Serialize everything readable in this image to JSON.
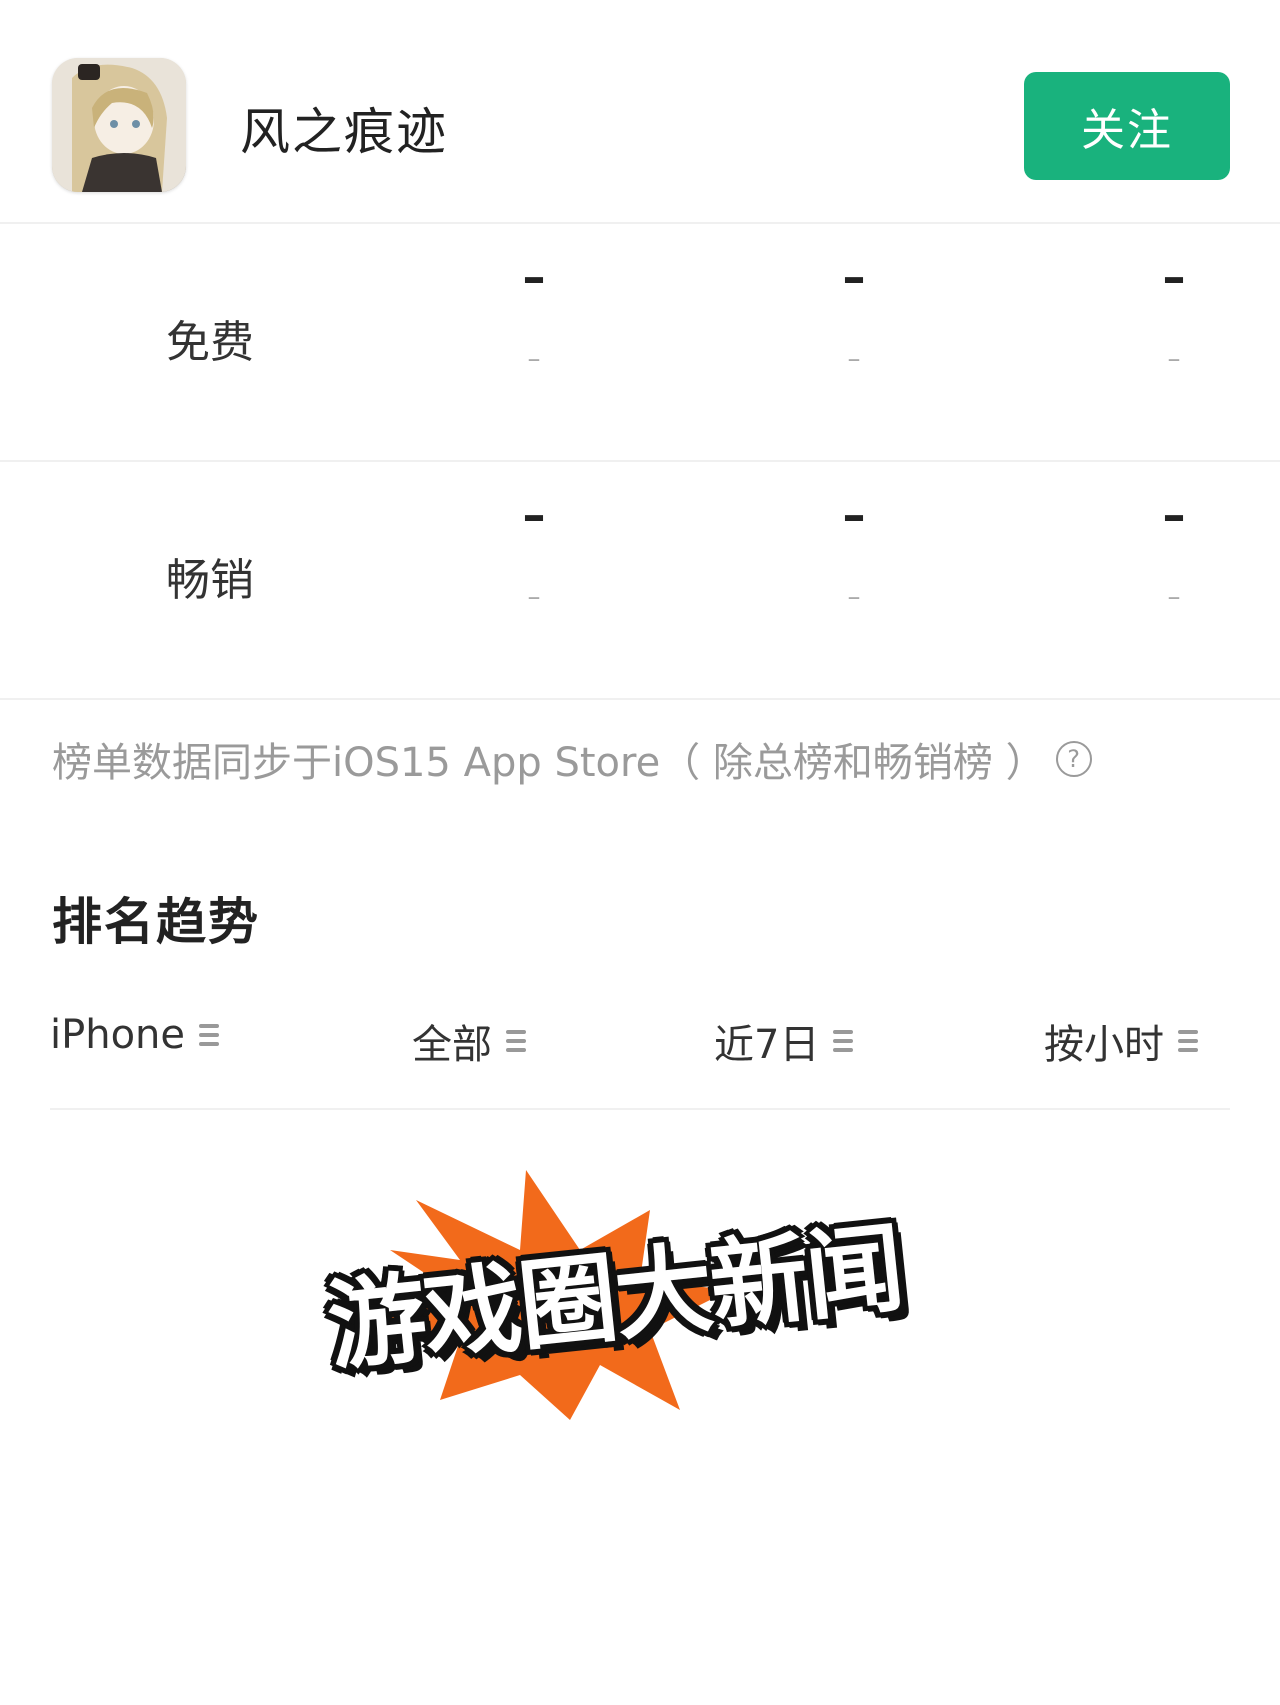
{
  "app": {
    "name": "风之痕迹",
    "icon_text": "风之痕迹",
    "follow_label": "关注"
  },
  "ranks": {
    "free": {
      "label": "免费",
      "values": [
        "–",
        "–",
        "–"
      ],
      "changes": [
        "–",
        "–",
        "–"
      ]
    },
    "paid": {
      "label": "畅销",
      "values": [
        "–",
        "–",
        "–"
      ],
      "changes": [
        "–",
        "–",
        "–"
      ]
    }
  },
  "note": {
    "text": "榜单数据同步于iOS15 App Store（ 除总榜和畅销榜 ）",
    "help_icon": "question-circle-icon"
  },
  "trend": {
    "title": "排名趋势",
    "filters": [
      {
        "label": "iPhone",
        "icon": "menu-icon"
      },
      {
        "label": "全部",
        "icon": "menu-icon"
      },
      {
        "label": "近7日",
        "icon": "menu-icon"
      },
      {
        "label": "按小时",
        "icon": "menu-icon"
      }
    ]
  },
  "watermark": {
    "text": "游戏圈大新闻",
    "burst_color": "#f26a1b"
  },
  "colors": {
    "accent": "#19b27d",
    "muted_text": "#9a9a9a",
    "divider": "#f0f0f0"
  }
}
